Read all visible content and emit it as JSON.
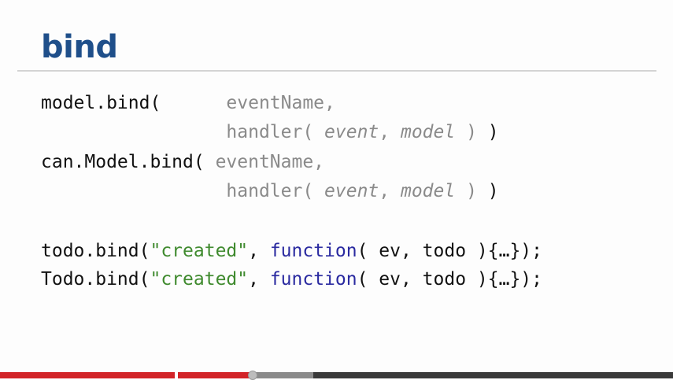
{
  "slide": {
    "title": "bind",
    "code": {
      "l1": {
        "a": "model.bind(      ",
        "b": "eventName,"
      },
      "l2": {
        "pad": "                 ",
        "h": "handler( ",
        "p1": "event",
        "sep": ", ",
        "p2": "model",
        "end": " )",
        "close": " )"
      },
      "l3": {
        "a": "can.Model.bind( ",
        "b": "eventName,"
      },
      "l4": {
        "pad": "                 ",
        "h": "handler( ",
        "p1": "event",
        "sep": ", ",
        "p2": "model",
        "end": " )",
        "close": " )"
      },
      "l5": {
        "a": "todo.bind(",
        "s": "\"created\"",
        "c": ", ",
        "k": "function",
        "r": "( ev, todo ){…});"
      },
      "l6": {
        "a": "Todo.bind(",
        "s": "\"created\"",
        "c": ", ",
        "k": "function",
        "r": "( ev, todo ){…});"
      }
    }
  },
  "player": {
    "progress_fraction": 0.375,
    "buffered_fraction": 0.465
  },
  "colors": {
    "title": "#1f4f8a",
    "string": "#3f8a2e",
    "keyword": "#2a2aa0",
    "dim": "#8a8a8a",
    "progress_watched": "#d22428"
  }
}
